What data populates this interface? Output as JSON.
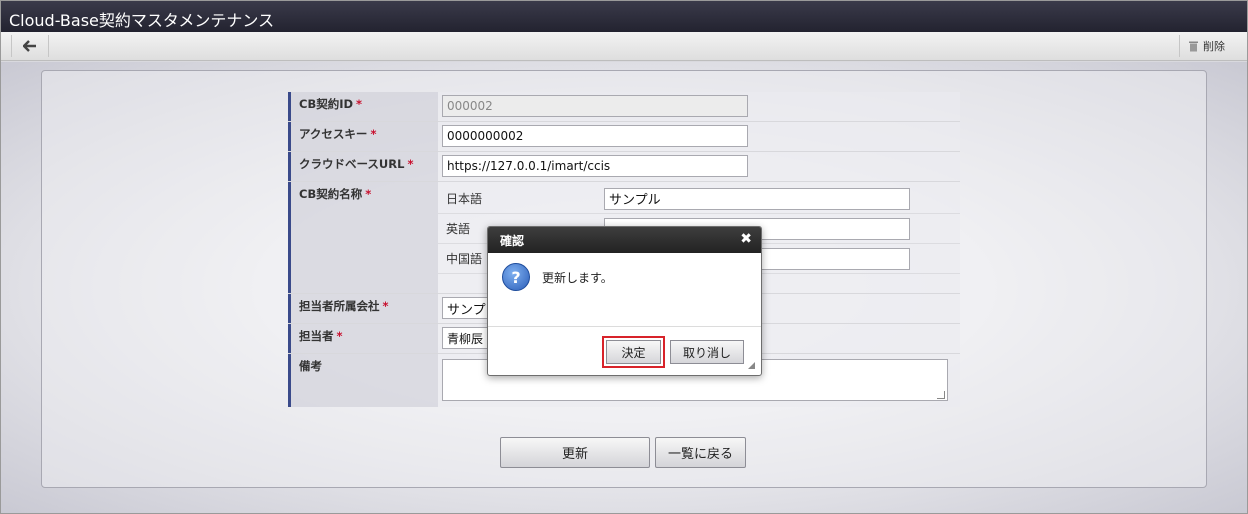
{
  "window": {
    "title": "Cloud-Base契約マスタメンテナンス"
  },
  "toolbar": {
    "delete_label": "削除"
  },
  "form": {
    "contract_id": {
      "label": "CB契約ID",
      "required": "*",
      "value": "000002"
    },
    "access_key": {
      "label": "アクセスキー",
      "required": "*",
      "value": "0000000002"
    },
    "cloud_base_url": {
      "label": "クラウドベースURL",
      "required": "*",
      "value": "https://127.0.0.1/imart/ccis"
    },
    "contract_name": {
      "label": "CB契約名称",
      "required": "*",
      "languages": [
        {
          "label": "日本語",
          "value": "サンプル"
        },
        {
          "label": "英語",
          "value": ""
        },
        {
          "label": "中国語",
          "value": ""
        }
      ]
    },
    "company": {
      "label": "担当者所属会社",
      "required": "*",
      "value": "サンプ"
    },
    "person": {
      "label": "担当者",
      "required": "*",
      "value": "青柳辰"
    },
    "remarks": {
      "label": "備考",
      "value": ""
    }
  },
  "actions": {
    "update_label": "更新",
    "back_label": "一覧に戻る"
  },
  "dialog": {
    "title": "確認",
    "message": "更新します。",
    "ok_label": "決定",
    "cancel_label": "取り消し",
    "icon": "question-icon"
  },
  "colors": {
    "titlebar": "#2a2a38",
    "label_accent": "#3a4a8a",
    "required": "#c8102e",
    "highlight": "#d8232a"
  }
}
